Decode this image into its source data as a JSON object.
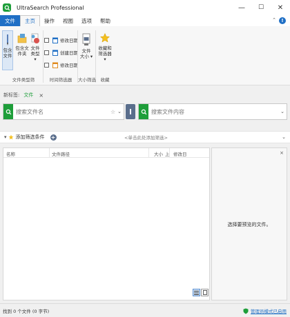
{
  "window": {
    "title": "UltraSearch Professional",
    "minimize": "—",
    "maximize": "☐",
    "close": "✕"
  },
  "menu": {
    "items": [
      {
        "label": "文件",
        "kind": "file"
      },
      {
        "label": "主页",
        "kind": "active"
      },
      {
        "label": "操作",
        "kind": ""
      },
      {
        "label": "视图",
        "kind": ""
      },
      {
        "label": "选项",
        "kind": ""
      },
      {
        "label": "帮助",
        "kind": ""
      }
    ],
    "collapse_glyph": "⌃",
    "help_glyph": "!"
  },
  "ribbon": {
    "search_folder_line1": "包含",
    "search_folder_line2": "文件",
    "include_folder_line1": "包含文",
    "include_folder_line2": "件夹",
    "file_type_line1": "文件",
    "file_type_line2": "类型 ▾",
    "date_modified": "修改日期",
    "date_created": "创建日期",
    "date_accessed": "修改日期",
    "file_size_line1": "文件",
    "file_size_line2": "大小 ▾",
    "favorites_line1": "收藏和",
    "favorites_line2": "筛选器 ▾",
    "groups": {
      "file_types": "文件类型筛",
      "time": "时间筛选器",
      "size": "大小筛选",
      "fav": "收藏"
    }
  },
  "breadcrumb": {
    "label": "新标签:",
    "tab": "文件",
    "close": "×"
  },
  "search": {
    "name_placeholder": "搜索文件名",
    "content_placeholder": "搜索文件内容",
    "clear_glyph": "☆",
    "dropdown_glyph": "⌄"
  },
  "filter": {
    "label": "添加筛选条件",
    "add_glyph": "+",
    "center_text": "<单击此处添加筛选>",
    "chev": "⌄"
  },
  "results": {
    "columns": [
      "名称",
      "文件路径",
      "大小",
      "上",
      "修改日"
    ]
  },
  "preview": {
    "close": "×",
    "message": "选择要预览的文件。"
  },
  "status": {
    "text": "找到 0 个文件 (0 字节)",
    "link": "管理员模式已启用"
  },
  "colors": {
    "accent": "#1f6fc5",
    "brand_green": "#1e9e3a"
  }
}
